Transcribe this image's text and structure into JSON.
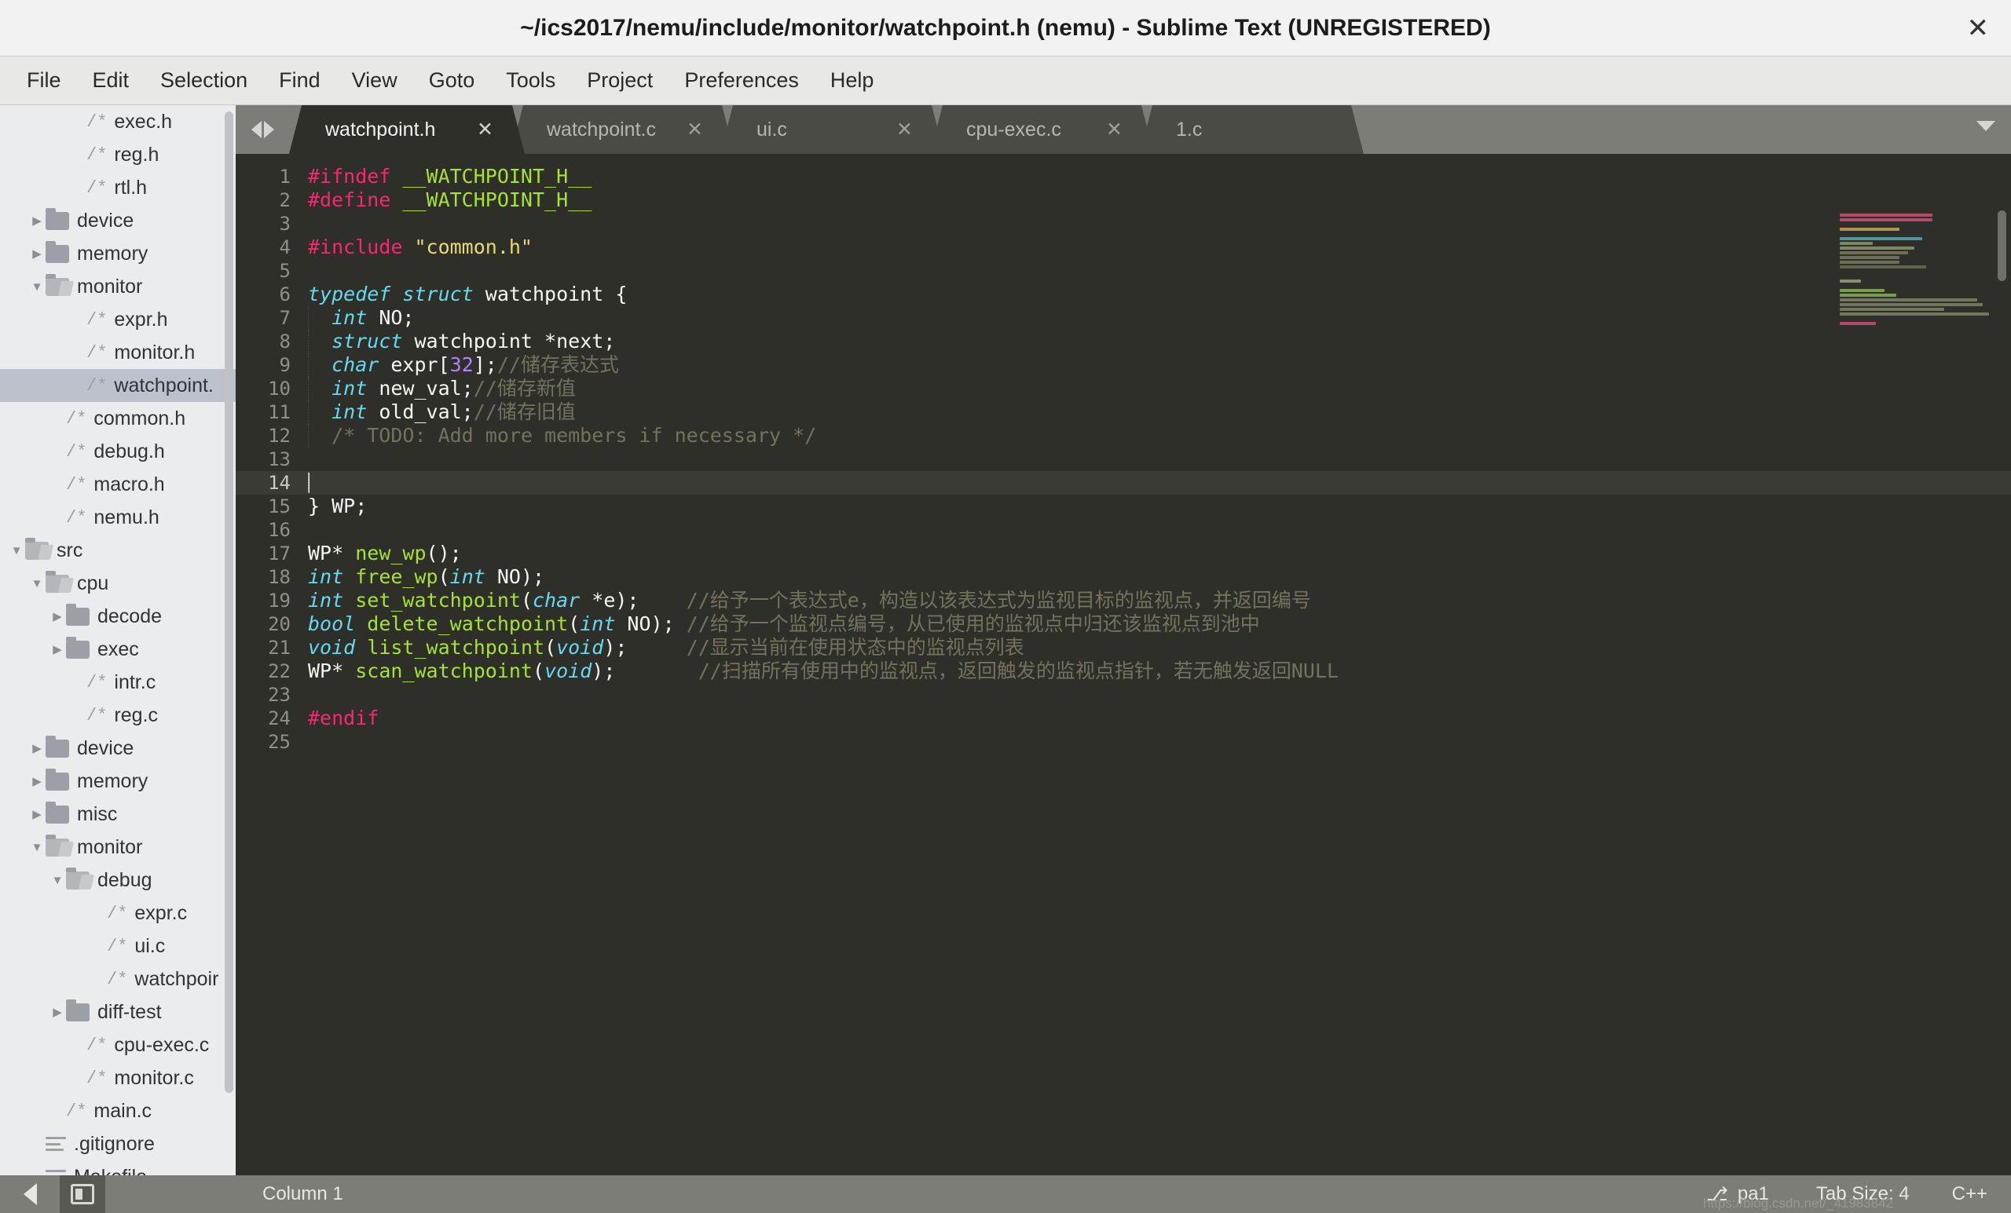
{
  "window": {
    "title": "~/ics2017/nemu/include/monitor/watchpoint.h (nemu) - Sublime Text (UNREGISTERED)",
    "close_label": "✕"
  },
  "menubar": {
    "items": [
      {
        "label": "File"
      },
      {
        "label": "Edit"
      },
      {
        "label": "Selection"
      },
      {
        "label": "Find"
      },
      {
        "label": "View"
      },
      {
        "label": "Goto"
      },
      {
        "label": "Tools"
      },
      {
        "label": "Project"
      },
      {
        "label": "Preferences"
      },
      {
        "label": "Help"
      }
    ]
  },
  "sidebar": {
    "items": [
      {
        "label": "exec.h",
        "type": "file",
        "indent": 3,
        "arrow": "none",
        "selected": false
      },
      {
        "label": "reg.h",
        "type": "file",
        "indent": 3,
        "arrow": "none",
        "selected": false
      },
      {
        "label": "rtl.h",
        "type": "file",
        "indent": 3,
        "arrow": "none",
        "selected": false
      },
      {
        "label": "device",
        "type": "folder",
        "indent": 1,
        "arrow": "closed",
        "selected": false
      },
      {
        "label": "memory",
        "type": "folder",
        "indent": 1,
        "arrow": "closed",
        "selected": false
      },
      {
        "label": "monitor",
        "type": "folder-open",
        "indent": 1,
        "arrow": "open",
        "selected": false
      },
      {
        "label": "expr.h",
        "type": "file",
        "indent": 3,
        "arrow": "none",
        "selected": false
      },
      {
        "label": "monitor.h",
        "type": "file",
        "indent": 3,
        "arrow": "none",
        "selected": false
      },
      {
        "label": "watchpoint.",
        "type": "file",
        "indent": 3,
        "arrow": "none",
        "selected": true
      },
      {
        "label": "common.h",
        "type": "file",
        "indent": 2,
        "arrow": "none",
        "selected": false
      },
      {
        "label": "debug.h",
        "type": "file",
        "indent": 2,
        "arrow": "none",
        "selected": false
      },
      {
        "label": "macro.h",
        "type": "file",
        "indent": 2,
        "arrow": "none",
        "selected": false
      },
      {
        "label": "nemu.h",
        "type": "file",
        "indent": 2,
        "arrow": "none",
        "selected": false
      },
      {
        "label": "src",
        "type": "folder-open",
        "indent": 0,
        "arrow": "open",
        "selected": false
      },
      {
        "label": "cpu",
        "type": "folder-open",
        "indent": 1,
        "arrow": "open",
        "selected": false
      },
      {
        "label": "decode",
        "type": "folder",
        "indent": 2,
        "arrow": "closed",
        "selected": false
      },
      {
        "label": "exec",
        "type": "folder",
        "indent": 2,
        "arrow": "closed",
        "selected": false
      },
      {
        "label": "intr.c",
        "type": "file",
        "indent": 3,
        "arrow": "none",
        "selected": false
      },
      {
        "label": "reg.c",
        "type": "file",
        "indent": 3,
        "arrow": "none",
        "selected": false
      },
      {
        "label": "device",
        "type": "folder",
        "indent": 1,
        "arrow": "closed",
        "selected": false
      },
      {
        "label": "memory",
        "type": "folder",
        "indent": 1,
        "arrow": "closed",
        "selected": false
      },
      {
        "label": "misc",
        "type": "folder",
        "indent": 1,
        "arrow": "closed",
        "selected": false
      },
      {
        "label": "monitor",
        "type": "folder-open",
        "indent": 1,
        "arrow": "open",
        "selected": false
      },
      {
        "label": "debug",
        "type": "folder-open",
        "indent": 2,
        "arrow": "open",
        "selected": false
      },
      {
        "label": "expr.c",
        "type": "file",
        "indent": 4,
        "arrow": "none",
        "selected": false
      },
      {
        "label": "ui.c",
        "type": "file",
        "indent": 4,
        "arrow": "none",
        "selected": false
      },
      {
        "label": "watchpoir",
        "type": "file",
        "indent": 4,
        "arrow": "none",
        "selected": false
      },
      {
        "label": "diff-test",
        "type": "folder",
        "indent": 2,
        "arrow": "closed",
        "selected": false
      },
      {
        "label": "cpu-exec.c",
        "type": "file",
        "indent": 3,
        "arrow": "none",
        "selected": false
      },
      {
        "label": "monitor.c",
        "type": "file",
        "indent": 3,
        "arrow": "none",
        "selected": false
      },
      {
        "label": "main.c",
        "type": "file",
        "indent": 2,
        "arrow": "none",
        "selected": false
      },
      {
        "label": ".gitignore",
        "type": "lines",
        "indent": 1,
        "arrow": "none",
        "selected": false
      },
      {
        "label": "Makefile",
        "type": "lines",
        "indent": 1,
        "arrow": "none",
        "selected": false
      }
    ]
  },
  "tabs": {
    "items": [
      {
        "label": "watchpoint.h",
        "active": true,
        "close": "✕"
      },
      {
        "label": "watchpoint.c",
        "active": false,
        "close": "✕"
      },
      {
        "label": "ui.c",
        "active": false,
        "close": "✕"
      },
      {
        "label": "cpu-exec.c",
        "active": false,
        "close": "✕"
      },
      {
        "label": "1.c",
        "active": false,
        "close": "✕"
      }
    ]
  },
  "editor": {
    "cursor_line": 14,
    "lines": [
      {
        "n": "1",
        "tokens": [
          {
            "t": "#ifndef ",
            "c": "pre"
          },
          {
            "t": "__WATCHPOINT_H__",
            "c": "def"
          }
        ]
      },
      {
        "n": "2",
        "tokens": [
          {
            "t": "#define ",
            "c": "pre"
          },
          {
            "t": "__WATCHPOINT_H__",
            "c": "def"
          }
        ]
      },
      {
        "n": "3",
        "tokens": []
      },
      {
        "n": "4",
        "tokens": [
          {
            "t": "#include ",
            "c": "pre"
          },
          {
            "t": "\"common.h\"",
            "c": "str"
          }
        ]
      },
      {
        "n": "5",
        "tokens": []
      },
      {
        "n": "6",
        "tokens": [
          {
            "t": "typedef struct",
            "c": "type"
          },
          {
            "t": " watchpoint {",
            "c": "pln"
          }
        ]
      },
      {
        "n": "7",
        "tokens": [
          {
            "t": "  ",
            "c": "pln"
          },
          {
            "t": "int",
            "c": "type"
          },
          {
            "t": " NO;",
            "c": "pln"
          }
        ]
      },
      {
        "n": "8",
        "tokens": [
          {
            "t": "  ",
            "c": "pln"
          },
          {
            "t": "struct",
            "c": "type"
          },
          {
            "t": " watchpoint *next;",
            "c": "pln"
          }
        ]
      },
      {
        "n": "9",
        "tokens": [
          {
            "t": "  ",
            "c": "pln"
          },
          {
            "t": "char",
            "c": "type"
          },
          {
            "t": " expr[",
            "c": "pln"
          },
          {
            "t": "32",
            "c": "num"
          },
          {
            "t": "];",
            "c": "pln"
          },
          {
            "t": "//储存表达式",
            "c": "cmt"
          }
        ]
      },
      {
        "n": "10",
        "tokens": [
          {
            "t": "  ",
            "c": "pln"
          },
          {
            "t": "int",
            "c": "type"
          },
          {
            "t": " new_val;",
            "c": "pln"
          },
          {
            "t": "//储存新值",
            "c": "cmt"
          }
        ]
      },
      {
        "n": "11",
        "tokens": [
          {
            "t": "  ",
            "c": "pln"
          },
          {
            "t": "int",
            "c": "type"
          },
          {
            "t": " old_val;",
            "c": "pln"
          },
          {
            "t": "//储存旧值",
            "c": "cmt"
          }
        ]
      },
      {
        "n": "12",
        "tokens": [
          {
            "t": "  /* TODO: Add more members if necessary */",
            "c": "cmt"
          }
        ]
      },
      {
        "n": "13",
        "tokens": []
      },
      {
        "n": "14",
        "tokens": []
      },
      {
        "n": "15",
        "tokens": [
          {
            "t": "} WP;",
            "c": "pln"
          }
        ]
      },
      {
        "n": "16",
        "tokens": []
      },
      {
        "n": "17",
        "tokens": [
          {
            "t": "WP* ",
            "c": "pln"
          },
          {
            "t": "new_wp",
            "c": "def"
          },
          {
            "t": "();",
            "c": "pln"
          }
        ]
      },
      {
        "n": "18",
        "tokens": [
          {
            "t": "int",
            "c": "type"
          },
          {
            "t": " ",
            "c": "pln"
          },
          {
            "t": "free_wp",
            "c": "def"
          },
          {
            "t": "(",
            "c": "pln"
          },
          {
            "t": "int",
            "c": "type"
          },
          {
            "t": " NO);",
            "c": "pln"
          }
        ]
      },
      {
        "n": "19",
        "tokens": [
          {
            "t": "int",
            "c": "type"
          },
          {
            "t": " ",
            "c": "pln"
          },
          {
            "t": "set_watchpoint",
            "c": "def"
          },
          {
            "t": "(",
            "c": "pln"
          },
          {
            "t": "char",
            "c": "type"
          },
          {
            "t": " *e);    ",
            "c": "pln"
          },
          {
            "t": "//给予一个表达式e，构造以该表达式为监视目标的监视点，并返回编号",
            "c": "cmt"
          }
        ]
      },
      {
        "n": "20",
        "tokens": [
          {
            "t": "bool",
            "c": "type"
          },
          {
            "t": " ",
            "c": "pln"
          },
          {
            "t": "delete_watchpoint",
            "c": "def"
          },
          {
            "t": "(",
            "c": "pln"
          },
          {
            "t": "int",
            "c": "type"
          },
          {
            "t": " NO); ",
            "c": "pln"
          },
          {
            "t": "//给予一个监视点编号，从已使用的监视点中归还该监视点到池中",
            "c": "cmt"
          }
        ]
      },
      {
        "n": "21",
        "tokens": [
          {
            "t": "void",
            "c": "type"
          },
          {
            "t": " ",
            "c": "pln"
          },
          {
            "t": "list_watchpoint",
            "c": "def"
          },
          {
            "t": "(",
            "c": "pln"
          },
          {
            "t": "void",
            "c": "type"
          },
          {
            "t": ");     ",
            "c": "pln"
          },
          {
            "t": "//显示当前在使用状态中的监视点列表",
            "c": "cmt"
          }
        ]
      },
      {
        "n": "22",
        "tokens": [
          {
            "t": "WP* ",
            "c": "pln"
          },
          {
            "t": "scan_watchpoint",
            "c": "def"
          },
          {
            "t": "(",
            "c": "pln"
          },
          {
            "t": "void",
            "c": "type"
          },
          {
            "t": ");       ",
            "c": "pln"
          },
          {
            "t": "//扫描所有使用中的监视点，返回触发的监视点指针，若无触发返回NULL",
            "c": "cmt"
          }
        ]
      },
      {
        "n": "23",
        "tokens": []
      },
      {
        "n": "24",
        "tokens": [
          {
            "t": "#endif",
            "c": "pre"
          }
        ]
      },
      {
        "n": "25",
        "tokens": []
      }
    ]
  },
  "minimap": {
    "rows": [
      {
        "w": "62%",
        "color": "#c8527a"
      },
      {
        "w": "62%",
        "color": "#c8527a"
      },
      {
        "w": "0%",
        "color": "#00000000"
      },
      {
        "w": "40%",
        "color": "#c8a35a"
      },
      {
        "w": "0%",
        "color": "#00000000"
      },
      {
        "w": "55%",
        "color": "#5aa8b8"
      },
      {
        "w": "22%",
        "color": "#8d9470"
      },
      {
        "w": "50%",
        "color": "#8d9470"
      },
      {
        "w": "46%",
        "color": "#7b7a5e"
      },
      {
        "w": "40%",
        "color": "#7b7a5e"
      },
      {
        "w": "40%",
        "color": "#7b7a5e"
      },
      {
        "w": "58%",
        "color": "#6e6c52"
      },
      {
        "w": "0%",
        "color": "#00000000"
      },
      {
        "w": "0%",
        "color": "#00000000"
      },
      {
        "w": "14%",
        "color": "#9aa07e"
      },
      {
        "w": "0%",
        "color": "#00000000"
      },
      {
        "w": "30%",
        "color": "#88b05a"
      },
      {
        "w": "38%",
        "color": "#88b05a"
      },
      {
        "w": "92%",
        "color": "#7f8468"
      },
      {
        "w": "96%",
        "color": "#7f8468"
      },
      {
        "w": "70%",
        "color": "#7f8468"
      },
      {
        "w": "100%",
        "color": "#7f8468"
      },
      {
        "w": "0%",
        "color": "#00000000"
      },
      {
        "w": "24%",
        "color": "#c8527a"
      }
    ]
  },
  "statusbar": {
    "column": "Column 1",
    "branch": "pa1",
    "branch_icon": "⎇",
    "tab_size": "Tab Size: 4",
    "language": "C++",
    "watermark": "https://blog.csdn.net/_41983842"
  }
}
